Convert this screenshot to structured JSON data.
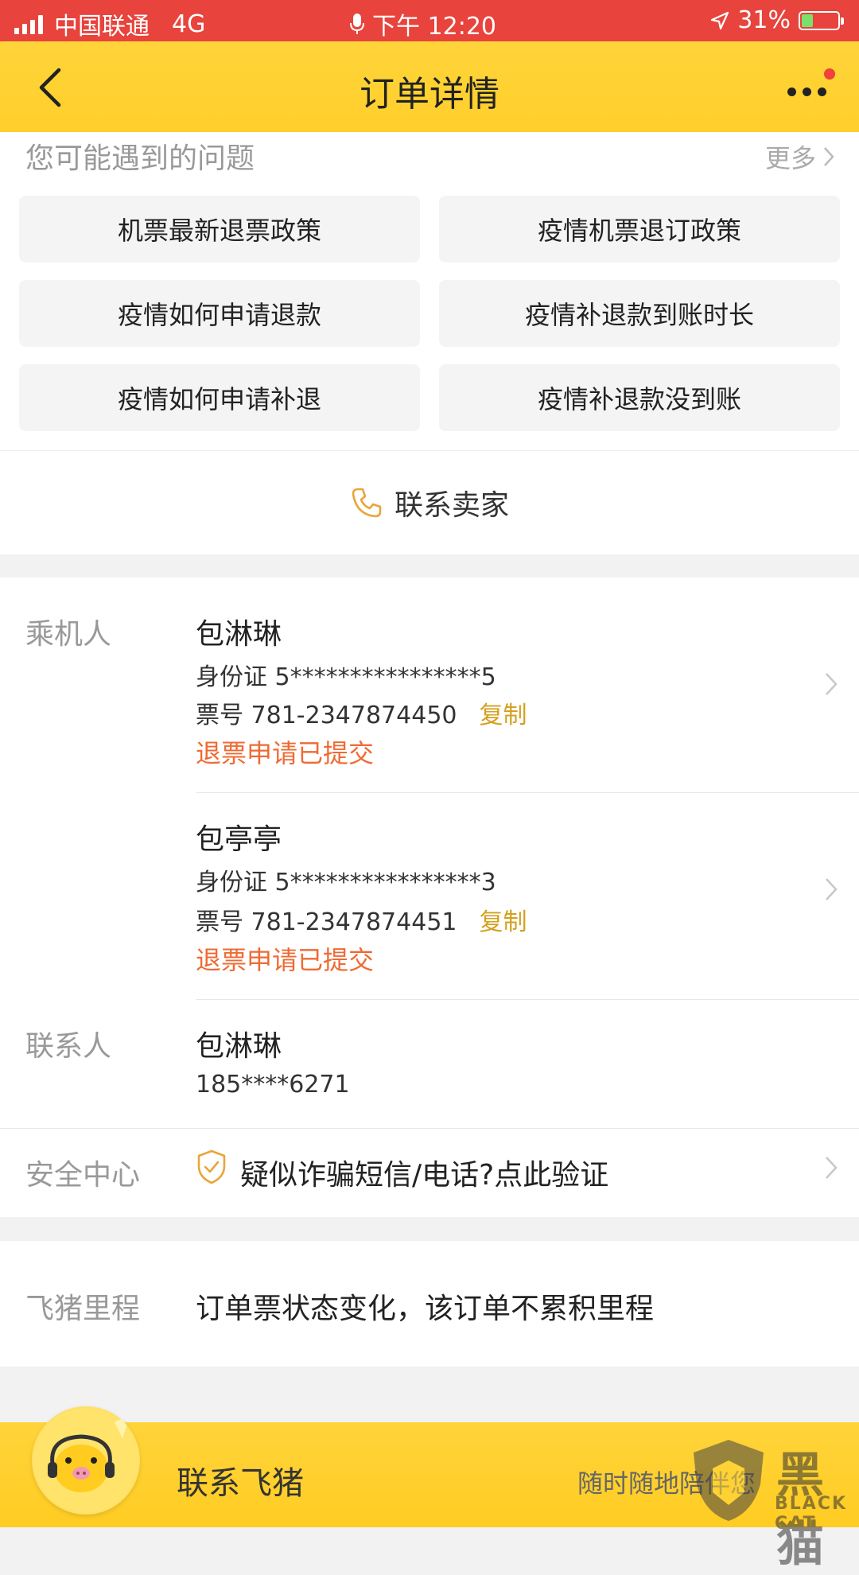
{
  "status_bar": {
    "carrier": "中国联通",
    "network": "4G",
    "time": "下午 12:20",
    "battery": "31%"
  },
  "nav": {
    "title": "订单详情",
    "back_icon": "back-chevron-icon",
    "more_icon": "more-dots-icon"
  },
  "faq": {
    "heading": "您可能遇到的问题",
    "more_label": "更多",
    "items": [
      {
        "label": "机票最新退票政策"
      },
      {
        "label": "疫情机票退订政策"
      },
      {
        "label": "疫情如何申请退款"
      },
      {
        "label": "疫情补退款到账时长"
      },
      {
        "label": "疫情如何申请补退"
      },
      {
        "label": "疫情补退款没到账"
      }
    ]
  },
  "contact_seller": {
    "label": "联系卖家",
    "icon": "phone-icon"
  },
  "passengers": {
    "label": "乘机人",
    "items": [
      {
        "name": "包淋琳",
        "id_line": "身份证 5****************5",
        "ticket_line": "票号 781-2347874450",
        "copy_label": "复制",
        "status": "退票申请已提交"
      },
      {
        "name": "包亭亭",
        "id_line": "身份证 5****************3",
        "ticket_line": "票号 781-2347874451",
        "copy_label": "复制",
        "status": "退票申请已提交"
      }
    ]
  },
  "contact_person": {
    "label": "联系人",
    "name": "包淋琳",
    "phone": "185****6271"
  },
  "security": {
    "label": "安全中心",
    "text": "疑似诈骗短信/电话?点此验证",
    "icon": "shield-check-icon"
  },
  "mileage": {
    "label": "飞猪里程",
    "text": "订单票状态变化，该订单不累积里程"
  },
  "bottom_bar": {
    "title": "联系飞猪",
    "subtitle": "随时随地陪伴您"
  },
  "watermark": {
    "text": "黑猫",
    "sub": "BLACK CAT"
  },
  "colors": {
    "status_bar": "#e8433c",
    "brand_yellow": "#ffd43a",
    "copy_link": "#d4a020",
    "status_orange": "#ef6a33"
  }
}
